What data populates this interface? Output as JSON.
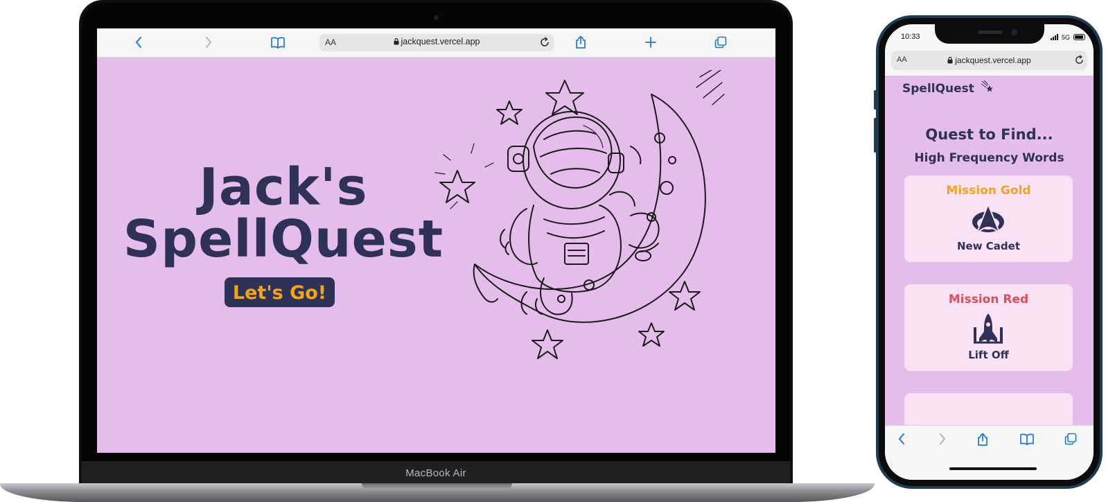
{
  "laptop": {
    "brand_label": "MacBook Air",
    "browser": {
      "reader_label": "AA",
      "url": "jackquest.vercel.app",
      "icons": [
        "back-icon",
        "forward-icon",
        "bookmarks-icon",
        "lock-icon",
        "reload-icon",
        "share-icon",
        "new-tab-icon",
        "tabs-icon"
      ]
    },
    "page": {
      "title_line1": "Jack's",
      "title_line2": "SpellQuest",
      "cta_label": "Let's Go!",
      "illustration": "astronaut-on-moon-illustration"
    }
  },
  "phone": {
    "status": {
      "time": "10:33",
      "network": "5G"
    },
    "browser": {
      "reader_label": "AA",
      "url": "jackquest.vercel.app"
    },
    "page": {
      "logo": "SpellQuest",
      "heading": "Quest to Find...",
      "subheading": "High Frequency Words",
      "missions": [
        {
          "title": "Mission Gold",
          "subtitle": "New Cadet",
          "icon": "starfleet-badge-icon"
        },
        {
          "title": "Mission Red",
          "subtitle": "Lift Off",
          "icon": "rocket-launch-icon"
        }
      ]
    },
    "toolbar_icons": [
      "back-icon",
      "forward-icon",
      "share-icon",
      "bookmarks-icon",
      "tabs-icon"
    ]
  },
  "colors": {
    "page_bg": "#e4bdea",
    "navy": "#2f3157",
    "gold": "#efa51e",
    "red": "#dc4f58",
    "card_bg": "#f9e2f3",
    "safari_blue": "#1f78d6"
  }
}
